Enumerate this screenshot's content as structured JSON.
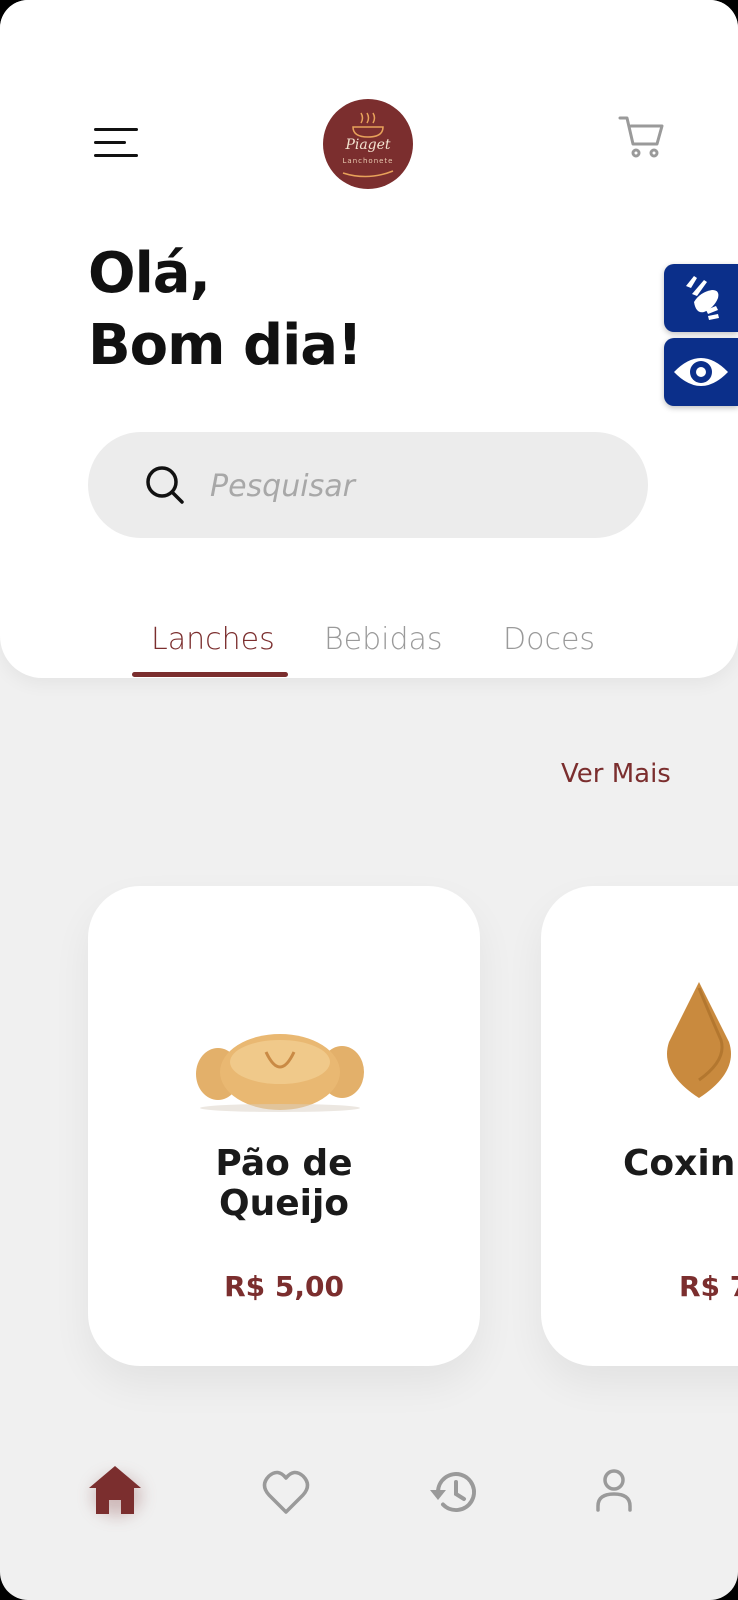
{
  "header": {
    "logo_text": "Piaget",
    "logo_sub": "Lanchonete"
  },
  "greeting": {
    "line1": "Olá,",
    "line2": "Bom dia!"
  },
  "search": {
    "placeholder": "Pesquisar"
  },
  "tabs": [
    {
      "label": "Lanches",
      "active": true
    },
    {
      "label": "Bebidas",
      "active": false
    },
    {
      "label": "Doces",
      "active": false
    }
  ],
  "section": {
    "ver_mais": "Ver Mais"
  },
  "products": [
    {
      "name_line1": "Pão de",
      "name_line2": "Queijo",
      "price": "R$ 5,00",
      "image": "pao-de-queijo"
    },
    {
      "name_line1": "Coxin",
      "name_line2": "",
      "price": "R$ 7",
      "image": "coxinha"
    }
  ],
  "accessibility": [
    {
      "icon": "sign-language-icon"
    },
    {
      "icon": "eye-icon"
    }
  ],
  "bottom_nav": [
    {
      "icon": "home-icon",
      "active": true
    },
    {
      "icon": "heart-icon",
      "active": false
    },
    {
      "icon": "history-icon",
      "active": false
    },
    {
      "icon": "user-icon",
      "active": false
    }
  ],
  "colors": {
    "accent": "#7b2e2e",
    "accessibility_blue": "#0b2f8a",
    "background": "#f0f0f0"
  }
}
